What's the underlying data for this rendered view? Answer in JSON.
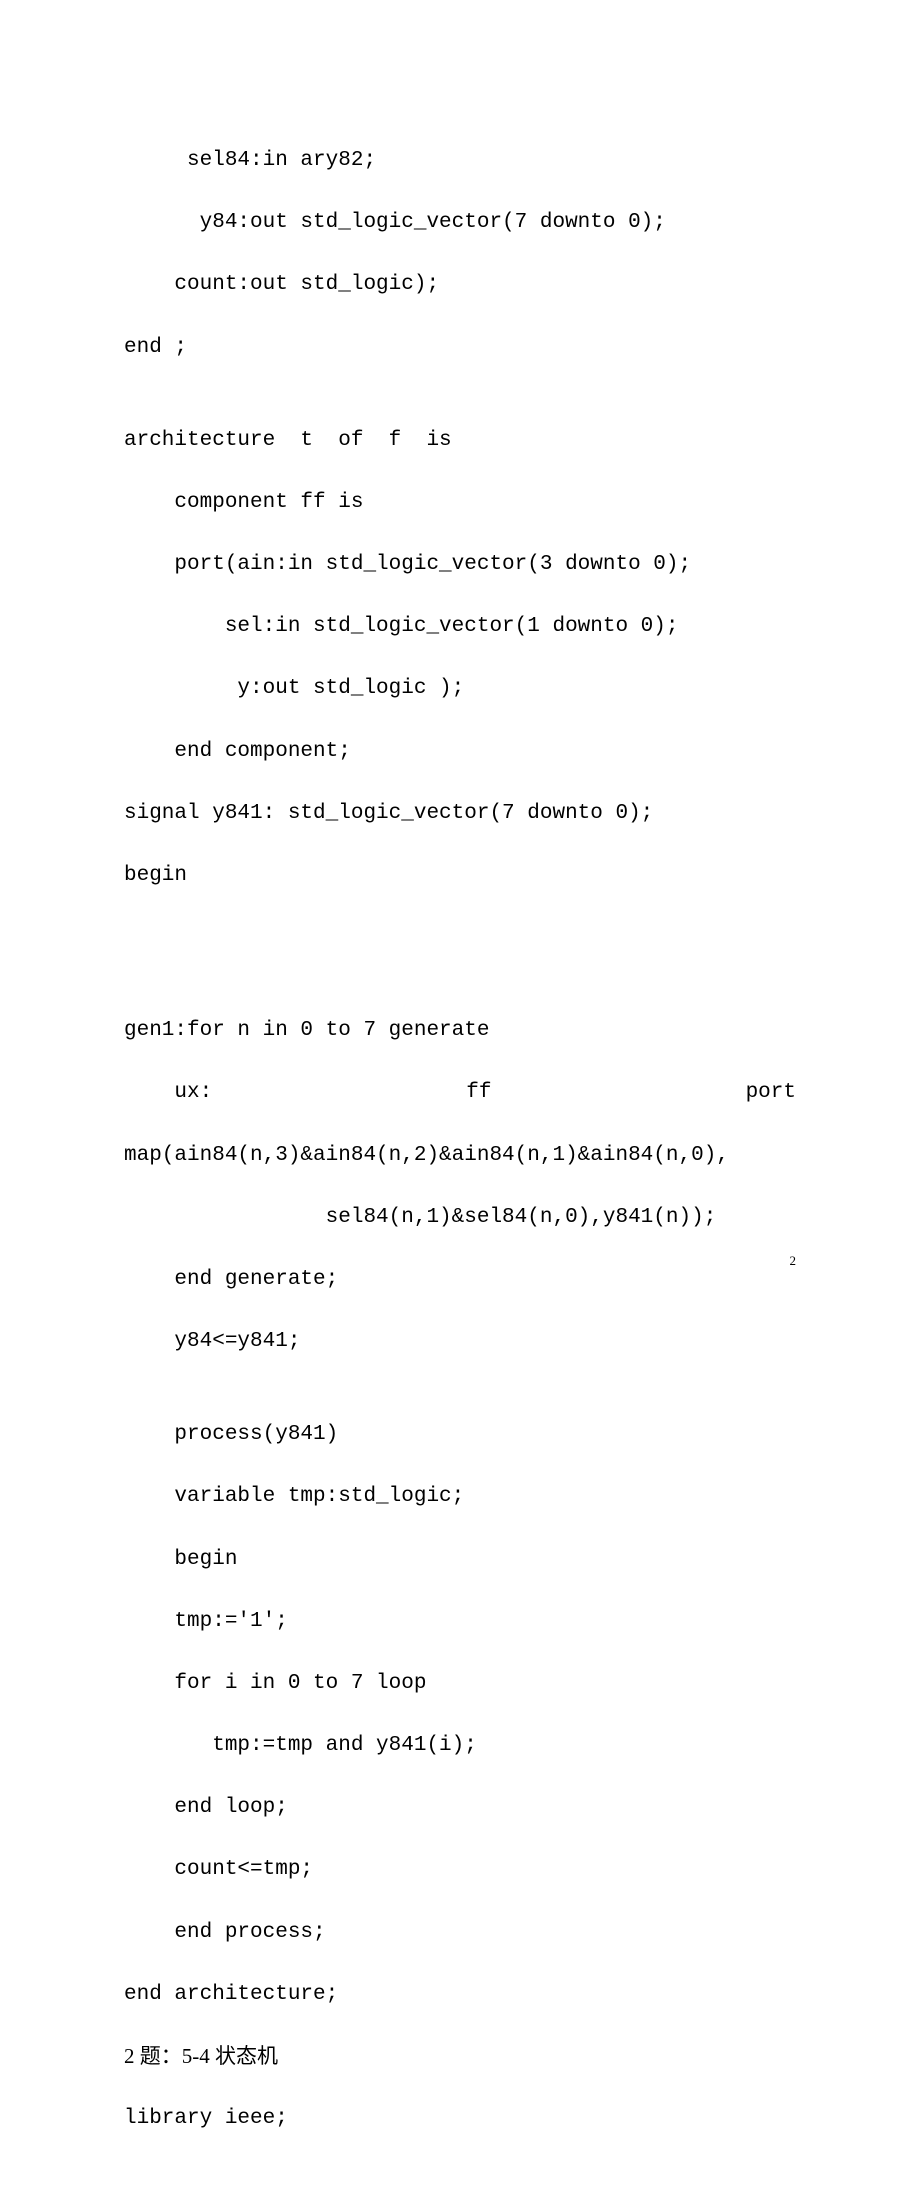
{
  "code": [
    "     sel84:in ary82;",
    "      y84:out std_logic_vector(7 downto 0);",
    "    count:out std_logic);",
    "end ;",
    "",
    "architecture  t  of  f  is",
    "    component ff is",
    "    port(ain:in std_logic_vector(3 downto 0);",
    "        sel:in std_logic_vector(1 downto 0);",
    "         y:out std_logic );",
    "    end component;",
    "signal y841: std_logic_vector(7 downto 0);",
    "begin",
    "",
    "",
    "",
    "gen1:for n in 0 to 7 generate"
  ],
  "justify_line": {
    "a": "    ux:",
    "b": "ff",
    "c": "port"
  },
  "code2": [
    "map(ain84(n,3)&ain84(n,2)&ain84(n,1)&ain84(n,0),",
    "                sel84(n,1)&sel84(n,0),y841(n));",
    "    end generate;",
    "    y84<=y841;",
    "",
    "    process(y841)",
    "    variable tmp:std_logic;",
    "    begin",
    "    tmp:='1';",
    "    for i in 0 to 7 loop",
    "       tmp:=tmp and y841(i);",
    "    end loop;",
    "    count<=tmp;",
    "    end process;",
    "end architecture;"
  ],
  "heading": "2 题：5-4 状态机",
  "after": [
    "library ieee;"
  ],
  "page_number": "2"
}
